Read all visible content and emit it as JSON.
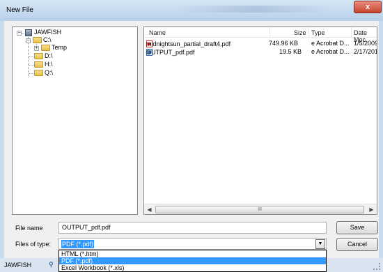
{
  "window": {
    "title": "New File",
    "close_glyph": "x"
  },
  "tree": {
    "root": "JAWFISH",
    "items": [
      {
        "label": "C:\\"
      },
      {
        "label": "Temp"
      },
      {
        "label": "D:\\"
      },
      {
        "label": "H:\\"
      },
      {
        "label": "Q:\\"
      }
    ]
  },
  "file_list": {
    "columns": [
      "Name",
      "Size",
      "Type",
      "Date Moc"
    ],
    "rows": [
      {
        "name": "midnightsun_partial_draft4.pdf",
        "size": "749.96 KB",
        "type": "e Acrobat D...",
        "date": "1/5/2009"
      },
      {
        "name": "OUTPUT_pdf.pdf",
        "size": "19.5 KB",
        "type": "e Acrobat D...",
        "date": "2/17/201"
      }
    ],
    "scroll_grip": "III"
  },
  "form": {
    "file_name_label": "File name",
    "file_name_value": "OUTPUT_pdf.pdf",
    "files_of_type_label": "Files of type:",
    "files_of_type_value": "PDF (*.pdf)",
    "save_label": "Save",
    "cancel_label": "Cancel"
  },
  "type_options": [
    "HTML (*.htm)",
    "PDF (*.pdf)",
    "Excel Workbook (*.xls)"
  ],
  "status": {
    "text": "JAWFISH"
  },
  "colors": {
    "selection": "#3399ff",
    "titlebar": "#c9dbee",
    "close_button": "#c7442c"
  }
}
